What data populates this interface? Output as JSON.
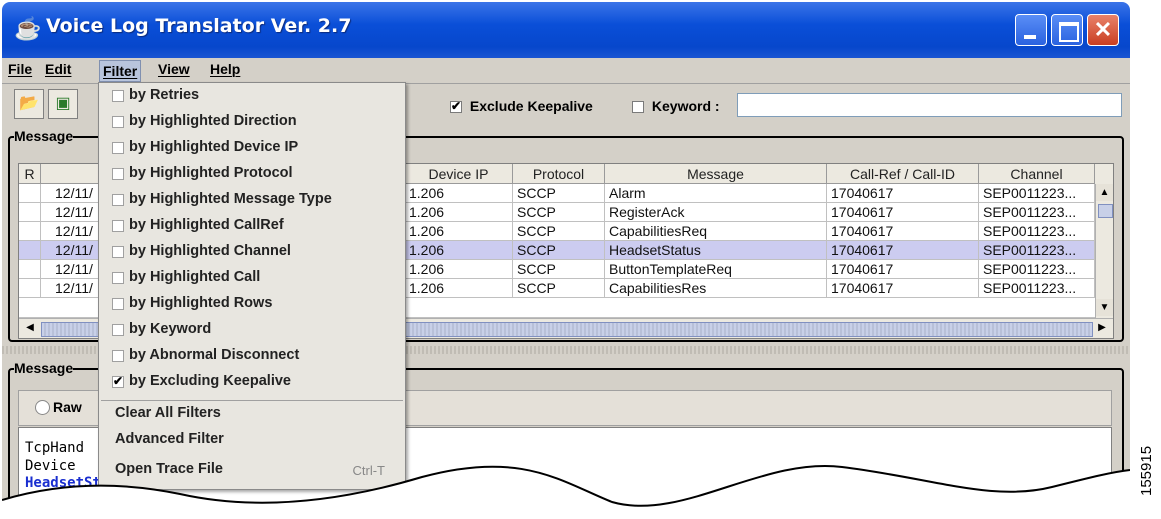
{
  "window": {
    "title": "Voice Log Translator Ver. 2.7"
  },
  "menubar": [
    {
      "label": "File"
    },
    {
      "label": "Edit"
    },
    {
      "label": "Filter"
    },
    {
      "label": "View"
    },
    {
      "label": "Help"
    }
  ],
  "toolbar": {
    "exclude_keepalive_label": "Exclude Keepalive",
    "exclude_keepalive_checked": true,
    "keyword_label": "Keyword :",
    "keyword_value": ""
  },
  "messages_panel": {
    "title": "Message",
    "columns": [
      "R",
      "",
      "Device IP",
      "Protocol",
      "Message",
      "Call-Ref / Call-ID",
      "Channel"
    ],
    "rows": [
      {
        "r": "",
        "time": "12/11/",
        "ip": "1.206",
        "protocol": "SCCP",
        "message": "Alarm",
        "callref": "17040617",
        "channel": "SEP0011223..."
      },
      {
        "r": "",
        "time": "12/11/",
        "ip": "1.206",
        "protocol": "SCCP",
        "message": "RegisterAck",
        "callref": "17040617",
        "channel": "SEP0011223..."
      },
      {
        "r": "",
        "time": "12/11/",
        "ip": "1.206",
        "protocol": "SCCP",
        "message": "CapabilitiesReq",
        "callref": "17040617",
        "channel": "SEP0011223..."
      },
      {
        "r": "",
        "time": "12/11/",
        "ip": "1.206",
        "protocol": "SCCP",
        "message": "HeadsetStatus",
        "callref": "17040617",
        "channel": "SEP0011223...",
        "selected": true
      },
      {
        "r": "",
        "time": "12/11/",
        "ip": "1.206",
        "protocol": "SCCP",
        "message": "ButtonTemplateReq",
        "callref": "17040617",
        "channel": "SEP0011223..."
      },
      {
        "r": "",
        "time": "12/11/",
        "ip": "1.206",
        "protocol": "SCCP",
        "message": "CapabilitiesRes",
        "callref": "17040617",
        "channel": "SEP0011223..."
      }
    ]
  },
  "detail_panel": {
    "title": "Message",
    "raw_label": "Raw",
    "lines": [
      "TcpHand",
      "Device",
      "HeadsetStatus"
    ]
  },
  "filter_menu": {
    "items": [
      {
        "label": "by Retries",
        "checked": false
      },
      {
        "label": "by Highlighted Direction",
        "checked": false
      },
      {
        "label": "by Highlighted Device IP",
        "checked": false
      },
      {
        "label": "by Highlighted Protocol",
        "checked": false
      },
      {
        "label": "by Highlighted Message Type",
        "checked": false
      },
      {
        "label": "by Highlighted CallRef",
        "checked": false
      },
      {
        "label": "by Highlighted Channel",
        "checked": false
      },
      {
        "label": "by Highlighted Call",
        "checked": false
      },
      {
        "label": "by Highlighted Rows",
        "checked": false
      },
      {
        "label": "by Keyword",
        "checked": false
      },
      {
        "label": "by Abnormal Disconnect",
        "checked": false
      },
      {
        "label": "by Excluding Keepalive",
        "checked": true
      }
    ],
    "actions": [
      {
        "label": "Clear All Filters",
        "shortcut": ""
      },
      {
        "label": "Advanced Filter",
        "shortcut": ""
      },
      {
        "label": "Open Trace File",
        "shortcut": "Ctrl-T"
      }
    ]
  },
  "figure_id": "155915",
  "colors": {
    "title_bar": "#0a4fd8",
    "selected_row": "#ccccf0",
    "detail_keyword": "#1a2fd0",
    "chrome": "#d4d0c8"
  }
}
